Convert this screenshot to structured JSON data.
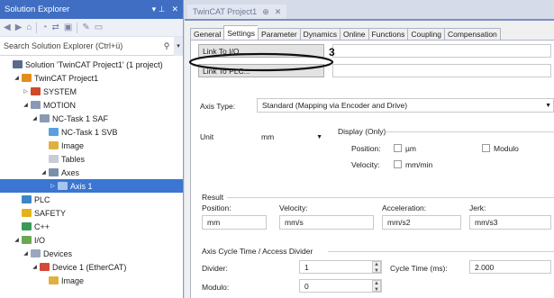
{
  "solution_explorer": {
    "title": "Solution Explorer",
    "pin_glyph": "▾ ⊥",
    "close_glyph": "✕",
    "search": {
      "placeholder": "Search Solution Explorer (Ctrl+ü)"
    },
    "tree": [
      {
        "label": "Solution 'TwinCAT Project1' (1 project)",
        "level": 0,
        "exp": "",
        "icon": "solution-icon",
        "color": "#5b6a8c"
      },
      {
        "label": "TwinCAT Project1",
        "level": 1,
        "exp": "◢",
        "icon": "project-icon",
        "color": "#e38c1c"
      },
      {
        "label": "SYSTEM",
        "level": 2,
        "exp": "▷",
        "icon": "system-icon",
        "color": "#d04a2a"
      },
      {
        "label": "MOTION",
        "level": 2,
        "exp": "◢",
        "icon": "motion-icon",
        "color": "#8a9ab5"
      },
      {
        "label": "NC-Task 1 SAF",
        "level": 3,
        "exp": "◢",
        "icon": "task-icon",
        "color": "#8a9ab5"
      },
      {
        "label": "NC-Task 1 SVB",
        "level": 4,
        "exp": "",
        "icon": "task-svb-icon",
        "color": "#5aa0e0"
      },
      {
        "label": "Image",
        "level": 4,
        "exp": "",
        "icon": "image-icon",
        "color": "#e0b040"
      },
      {
        "label": "Tables",
        "level": 4,
        "exp": "",
        "icon": "tables-icon",
        "color": "#c7ccd6"
      },
      {
        "label": "Axes",
        "level": 4,
        "exp": "◢",
        "icon": "axes-icon",
        "color": "#7a8fa8"
      },
      {
        "label": "Axis 1",
        "level": 5,
        "exp": "▷",
        "icon": "axis-icon",
        "color": "#a8c4ef",
        "selected": true
      },
      {
        "label": "PLC",
        "level": 1,
        "exp": "",
        "icon": "plc-icon",
        "color": "#3c86c6"
      },
      {
        "label": "SAFETY",
        "level": 1,
        "exp": "",
        "icon": "safety-icon",
        "color": "#e3b21c"
      },
      {
        "label": "C++",
        "level": 1,
        "exp": "",
        "icon": "cpp-icon",
        "color": "#3a9a5a"
      },
      {
        "label": "I/O",
        "level": 1,
        "exp": "◢",
        "icon": "io-icon",
        "color": "#6aa84f"
      },
      {
        "label": "Devices",
        "level": 2,
        "exp": "◢",
        "icon": "devices-icon",
        "color": "#9aa7bd"
      },
      {
        "label": "Device 1 (EtherCAT)",
        "level": 3,
        "exp": "◢",
        "icon": "ethercat-icon",
        "color": "#d24a3a"
      },
      {
        "label": "Image",
        "level": 4,
        "exp": "",
        "icon": "image-icon",
        "color": "#e0b040"
      }
    ]
  },
  "document": {
    "tab_title": "TwinCAT Project1",
    "tab_pin": "⊕",
    "tab_close": "✕",
    "tabs": [
      "General",
      "Settings",
      "Parameter",
      "Dynamics",
      "Online",
      "Functions",
      "Coupling",
      "Compensation"
    ],
    "active_tab": "Settings",
    "link_io": "Link To I/O...",
    "link_plc": "Link To PLC...",
    "annotation_number": "3",
    "axis_type_label": "Axis Type:",
    "axis_type_value": "Standard (Mapping via Encoder and Drive)",
    "unit_label": "Unit",
    "unit_value": "mm",
    "display_label": "Display (Only)",
    "position_label": "Position:",
    "um_label": "µm",
    "modulo_check_label": "Modulo",
    "velocity_label": "Velocity:",
    "mmmin_label": "mm/min",
    "result": {
      "title": "Result",
      "headers": [
        "Position:",
        "Velocity:",
        "Acceleration:",
        "Jerk:"
      ],
      "values": [
        "mm",
        "mm/s",
        "mm/s2",
        "mm/s3"
      ]
    },
    "cycle": {
      "title": "Axis Cycle Time / Access Divider",
      "divider_label": "Divider:",
      "divider_value": "1",
      "cycle_time_label": "Cycle Time (ms):",
      "cycle_time_value": "2.000",
      "modulo_label": "Modulo:",
      "modulo_value": "0"
    }
  }
}
